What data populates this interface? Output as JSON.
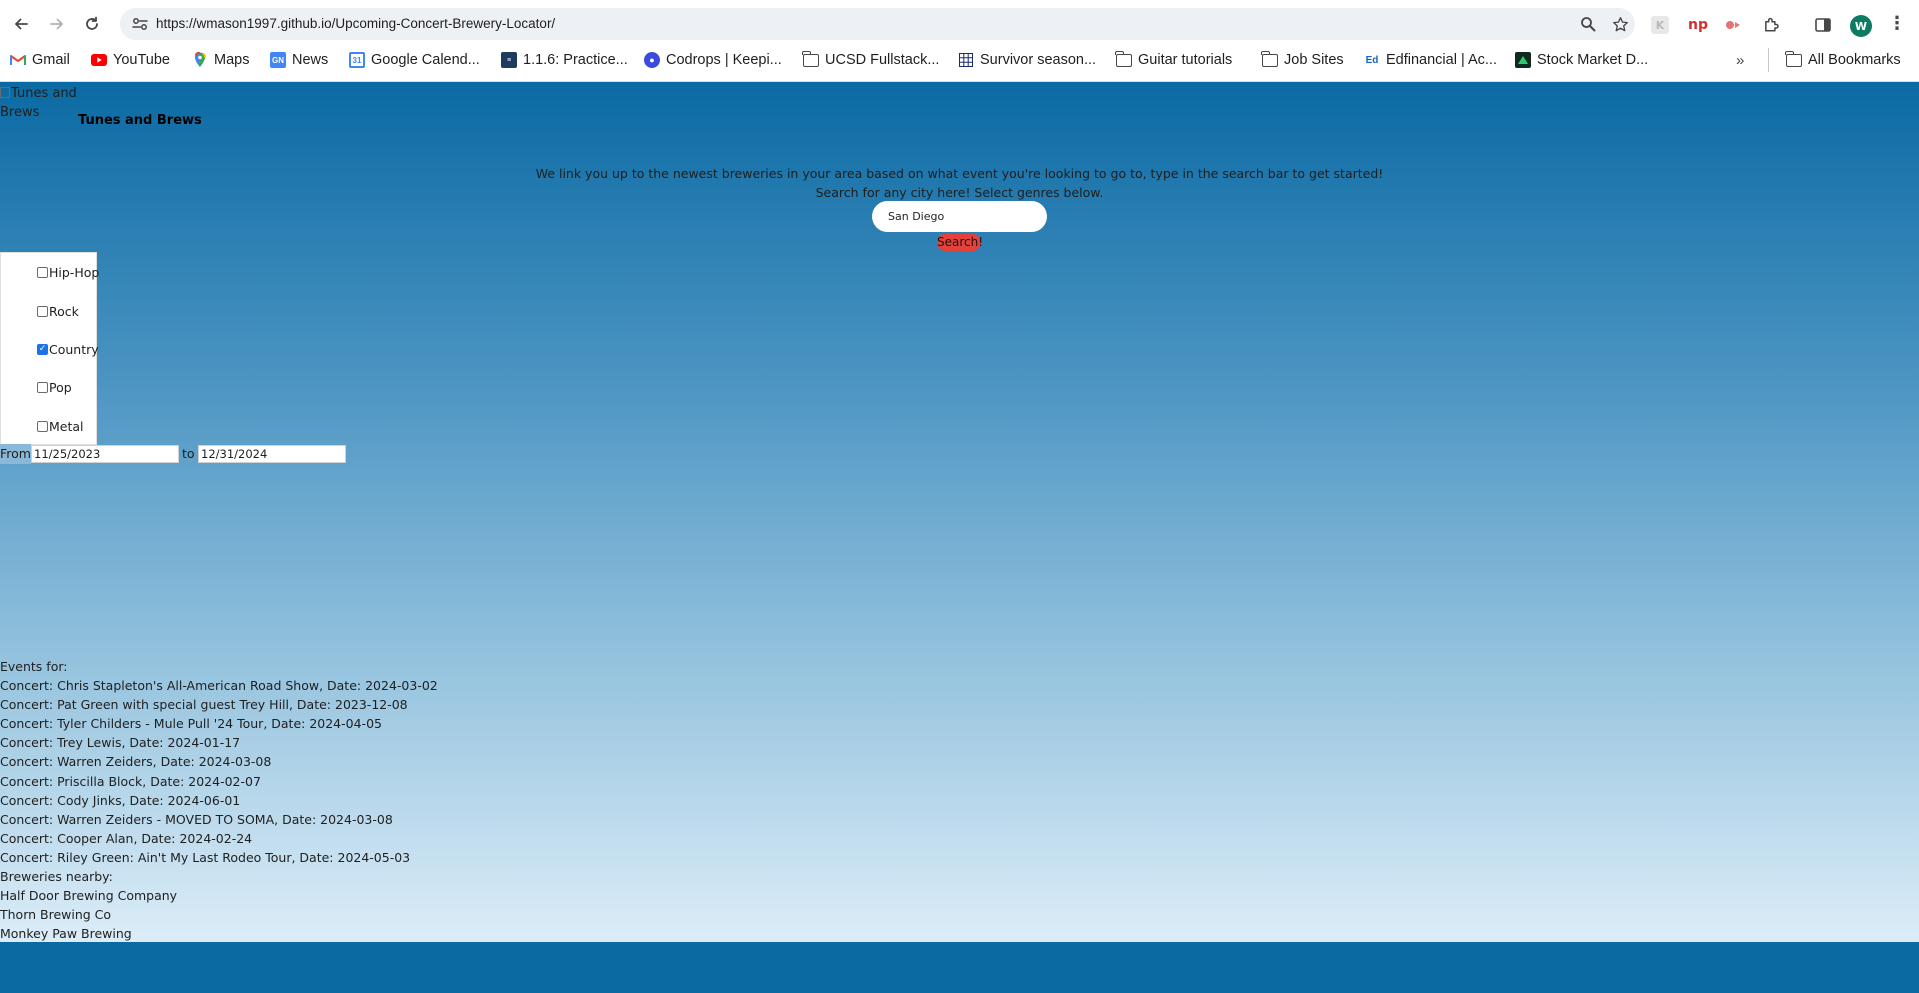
{
  "browser": {
    "url": "https://wmason1997.github.io/Upcoming-Concert-Brewery-Locator/",
    "profile_initial": "W",
    "bookmarks": [
      {
        "label": "Gmail",
        "icon": "gmail-icon"
      },
      {
        "label": "YouTube",
        "icon": "youtube-icon"
      },
      {
        "label": "Maps",
        "icon": "maps-icon"
      },
      {
        "label": "News",
        "icon": "news-icon"
      },
      {
        "label": "Google Calend...",
        "icon": "calendar-icon"
      },
      {
        "label": "1.1.6: Practice...",
        "icon": "practice-icon"
      },
      {
        "label": "Codrops | Keepi...",
        "icon": "codrops-icon"
      },
      {
        "label": "UCSD Fullstack...",
        "icon": "folder-icon"
      },
      {
        "label": "Survivor season...",
        "icon": "sheet-icon"
      },
      {
        "label": "Guitar tutorials",
        "icon": "folder-icon"
      },
      {
        "label": "Job Sites",
        "icon": "folder-icon"
      },
      {
        "label": "Edfinancial | Ac...",
        "icon": "edfinancial-icon"
      },
      {
        "label": "Stock Market D...",
        "icon": "stock-icon"
      }
    ],
    "all_bookmarks_label": "All Bookmarks"
  },
  "header": {
    "logo_alt": "Tunes and Brews",
    "title": "Tunes and Brews"
  },
  "intro": {
    "line1": "We link you up to the newest breweries in your area based on what event you're looking to go to, type in the search bar to get started!",
    "line2": "Search for any city here! Select genres below."
  },
  "search": {
    "value": "San Diego",
    "button_label": "Search!"
  },
  "genres": [
    {
      "label": "Hip-Hop",
      "checked": false
    },
    {
      "label": "Rock",
      "checked": false
    },
    {
      "label": "Country",
      "checked": true
    },
    {
      "label": "Pop",
      "checked": false
    },
    {
      "label": "Metal",
      "checked": false
    }
  ],
  "dates": {
    "from_label": "From",
    "from_value": "11/25/2023",
    "to_label": "to",
    "to_value": "12/31/2024"
  },
  "results": {
    "events_heading": "Events for:",
    "events": [
      "Concert: Chris Stapleton's All-American Road Show, Date: 2024-03-02",
      "Concert: Pat Green with special guest Trey Hill, Date: 2023-12-08",
      "Concert: Tyler Childers - Mule Pull '24 Tour, Date: 2024-04-05",
      "Concert: Trey Lewis, Date: 2024-01-17",
      "Concert: Warren Zeiders, Date: 2024-03-08",
      "Concert: Priscilla Block, Date: 2024-02-07",
      "Concert: Cody Jinks, Date: 2024-06-01",
      "Concert: Warren Zeiders - MOVED TO SOMA, Date: 2024-03-08",
      "Concert: Cooper Alan, Date: 2024-02-24",
      "Concert: Riley Green: Ain't My Last Rodeo Tour, Date: 2024-05-03"
    ],
    "breweries_heading": "Breweries nearby:",
    "breweries": [
      "Half Door Brewing Company",
      "Thorn Brewing Co",
      "Monkey Paw Brewing"
    ]
  }
}
